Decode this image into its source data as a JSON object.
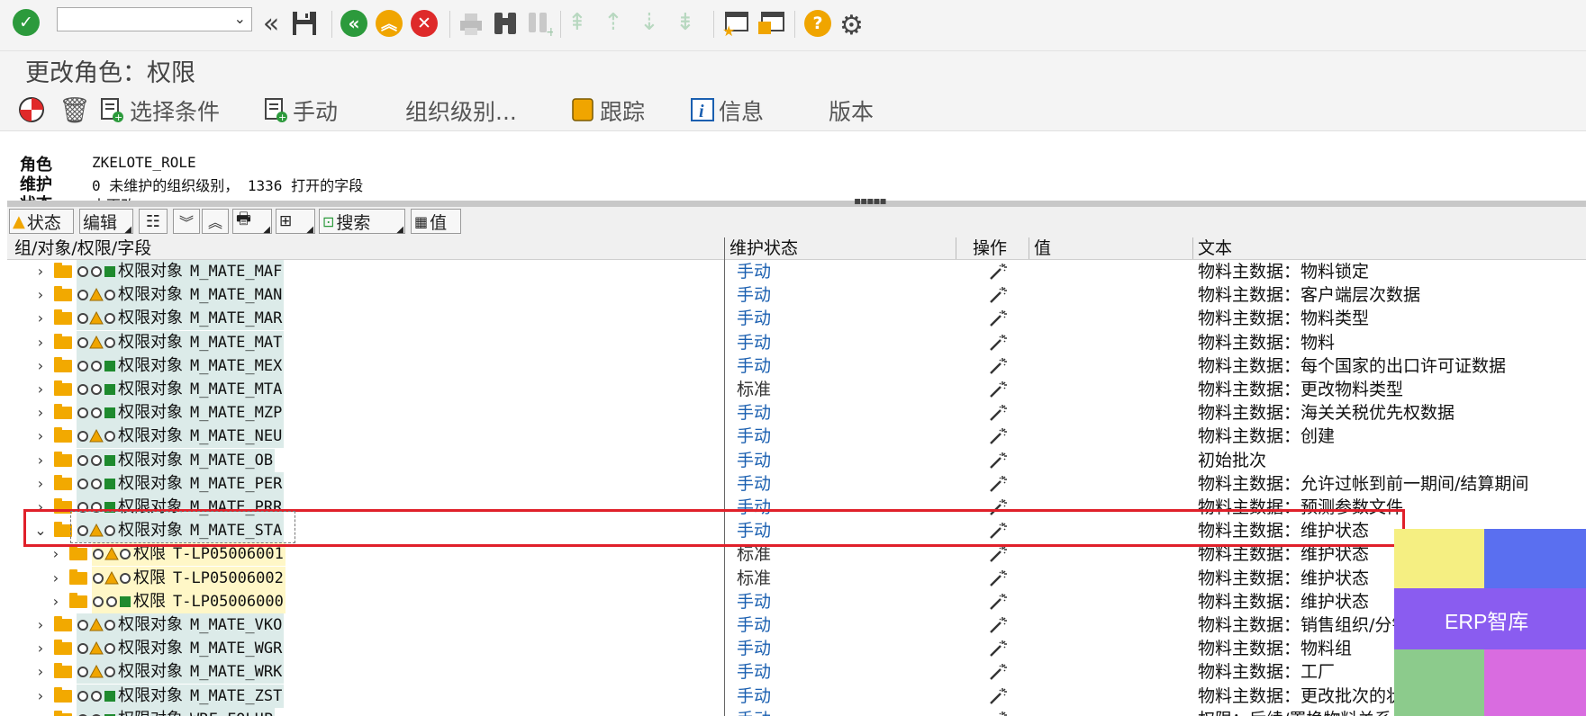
{
  "title": "更改角色：权限",
  "system_toolbar": {
    "command_field_value": "",
    "icons": [
      "enter-icon",
      "back-double-icon",
      "save-icon",
      "back-icon",
      "exit-icon",
      "cancel-icon",
      "print-icon",
      "find-icon",
      "find-next-icon",
      "first-page-icon",
      "prev-page-icon",
      "next-page-icon",
      "last-page-icon",
      "new-session-icon",
      "shortcut-icon",
      "help-icon",
      "settings-icon"
    ]
  },
  "app_toolbar": {
    "selection_criteria": "选择条件",
    "manual": "手动",
    "org_levels": "组织级别...",
    "trace": "跟踪",
    "info": "信息",
    "version": "版本"
  },
  "header": {
    "role_label": "角色",
    "role_value": "ZKELOTE_ROLE",
    "maint_label": "维护",
    "maint_value": "0 未维护的组织级别， 1336 打开的字段",
    "status_label": "状态",
    "status_value": "未更改"
  },
  "tree_toolbar": {
    "status": "状态",
    "edit": "编辑",
    "search": "搜索",
    "value": "值"
  },
  "columns": {
    "tree": "组/对象/权限/字段",
    "maint_status": "维护状态",
    "operation": "操作",
    "value": "值",
    "text": "文本"
  },
  "rows": [
    {
      "level": 1,
      "expanded": false,
      "lights": [
        "o",
        "o",
        "g"
      ],
      "type": "权限对象",
      "name": "M_MATE_MAF",
      "status": "手动",
      "text": "物料主数据：物料锁定"
    },
    {
      "level": 1,
      "expanded": false,
      "lights": [
        "o",
        "y",
        "o"
      ],
      "type": "权限对象",
      "name": "M_MATE_MAN",
      "status": "手动",
      "text": "物料主数据：客户端层次数据"
    },
    {
      "level": 1,
      "expanded": false,
      "lights": [
        "o",
        "y",
        "o"
      ],
      "type": "权限对象",
      "name": "M_MATE_MAR",
      "status": "手动",
      "text": "物料主数据：物料类型"
    },
    {
      "level": 1,
      "expanded": false,
      "lights": [
        "o",
        "y",
        "o"
      ],
      "type": "权限对象",
      "name": "M_MATE_MAT",
      "status": "手动",
      "text": "物料主数据：物料"
    },
    {
      "level": 1,
      "expanded": false,
      "lights": [
        "o",
        "o",
        "g"
      ],
      "type": "权限对象",
      "name": "M_MATE_MEX",
      "status": "手动",
      "text": "物料主数据：每个国家的出口许可证数据"
    },
    {
      "level": 1,
      "expanded": false,
      "lights": [
        "o",
        "o",
        "g"
      ],
      "type": "权限对象",
      "name": "M_MATE_MTA",
      "status": "标准",
      "text": "物料主数据：更改物料类型"
    },
    {
      "level": 1,
      "expanded": false,
      "lights": [
        "o",
        "o",
        "g"
      ],
      "type": "权限对象",
      "name": "M_MATE_MZP",
      "status": "手动",
      "text": "物料主数据：海关关税优先权数据"
    },
    {
      "level": 1,
      "expanded": false,
      "lights": [
        "o",
        "y",
        "o"
      ],
      "type": "权限对象",
      "name": "M_MATE_NEU",
      "status": "手动",
      "text": "物料主数据：创建"
    },
    {
      "level": 1,
      "expanded": false,
      "lights": [
        "o",
        "o",
        "g"
      ],
      "type": "权限对象",
      "name": "M_MATE_OB",
      "status": "手动",
      "text": "初始批次"
    },
    {
      "level": 1,
      "expanded": false,
      "lights": [
        "o",
        "o",
        "g"
      ],
      "type": "权限对象",
      "name": "M_MATE_PER",
      "status": "手动",
      "text": "物料主数据：允许过帐到前一期间/结算期间"
    },
    {
      "level": 1,
      "expanded": false,
      "lights": [
        "o",
        "o",
        "g"
      ],
      "type": "权限对象",
      "name": "M_MATE_PRR",
      "status": "手动",
      "text": "物料主数据：预测参数文件"
    },
    {
      "level": 1,
      "expanded": true,
      "lights": [
        "o",
        "y",
        "o"
      ],
      "type": "权限对象",
      "name": "M_MATE_STA",
      "status": "手动",
      "text": "物料主数据：维护状态"
    },
    {
      "level": 2,
      "expanded": false,
      "lights": [
        "o",
        "y",
        "o"
      ],
      "type": "权限",
      "name": "T-LP05006001",
      "status": "标准",
      "text": "物料主数据：维护状态"
    },
    {
      "level": 2,
      "expanded": false,
      "lights": [
        "o",
        "y",
        "o"
      ],
      "type": "权限",
      "name": "T-LP05006002",
      "status": "标准",
      "text": "物料主数据：维护状态"
    },
    {
      "level": 2,
      "expanded": false,
      "lights": [
        "o",
        "o",
        "g"
      ],
      "type": "权限",
      "name": "T-LP05006000",
      "status": "手动",
      "text": "物料主数据：维护状态"
    },
    {
      "level": 1,
      "expanded": false,
      "lights": [
        "o",
        "y",
        "o"
      ],
      "type": "权限对象",
      "name": "M_MATE_VKO",
      "status": "手动",
      "text": "物料主数据：销售组织/分销渠道"
    },
    {
      "level": 1,
      "expanded": false,
      "lights": [
        "o",
        "y",
        "o"
      ],
      "type": "权限对象",
      "name": "M_MATE_WGR",
      "status": "手动",
      "text": "物料主数据：物料组"
    },
    {
      "level": 1,
      "expanded": false,
      "lights": [
        "o",
        "y",
        "o"
      ],
      "type": "权限对象",
      "name": "M_MATE_WRK",
      "status": "手动",
      "text": "物料主数据：工厂"
    },
    {
      "level": 1,
      "expanded": false,
      "lights": [
        "o",
        "o",
        "g"
      ],
      "type": "权限对象",
      "name": "M_MATE_ZST",
      "status": "手动",
      "text": "物料主数据：更改批次的状态"
    },
    {
      "level": 1,
      "expanded": false,
      "lights": [
        "o",
        "o",
        "g"
      ],
      "type": "权限对象",
      "name": "WRF_FOLUP",
      "status": "手动",
      "text": "权限：后续/置换物料关系"
    }
  ],
  "watermark": {
    "text": "ERP智库",
    "colors": [
      "#f5ef82",
      "#5a6ff0",
      "#8a5cf0",
      "#8ccb8c",
      "#d96ce0"
    ]
  },
  "colors": {
    "status_manual": "#1a5fb0",
    "highlight": "#e0202a",
    "folder": "#f2a900"
  }
}
